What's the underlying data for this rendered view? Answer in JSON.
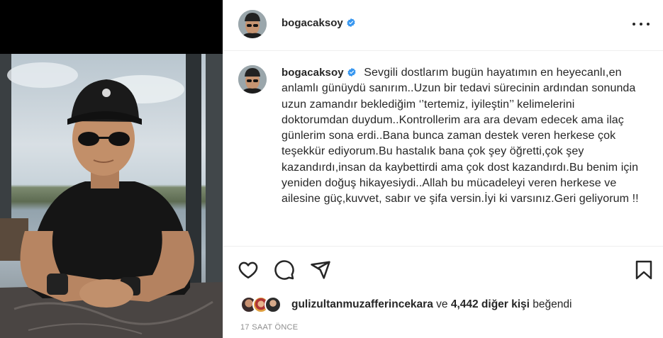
{
  "post": {
    "author": "bogacaksoy",
    "verified": true,
    "caption": "Sevgili dostlarım bugün hayatımın en heyecanlı,en anlamlı günüydü sanırım..Uzun bir tedavi sürecinin ardından sonunda uzun zamandır beklediğim ‘’tertemiz, iyileştin’’ kelimelerini doktorumdan duydum..Kontrollerim ara ara devam edecek ama ilaç günlerim sona erdi..Bana bunca zaman destek veren herkese çok teşekkür ediyorum.Bu hastalık bana çok şey öğretti,çok şey kazandırdı,insan da kaybettirdi ama çok dost kazandırdı.Bu benim için yeniden doğuş hikayesiydi..Allah bu mücadeleyi veren herkese ve ailesine güç,kuvvet, sabır ve şifa versin.İyi ki varsınız.Geri geliyorum !!",
    "likes": {
      "first_liker": "gulizultanmuzafferincekara",
      "connector": "ve",
      "others": "4,442 diğer kişi",
      "suffix": "beğendi"
    },
    "timestamp": "17 SAAT ÖNCE"
  },
  "icons": {
    "verified": "verified-badge-icon",
    "more": "more-options-icon",
    "like": "heart-icon",
    "comment": "comment-icon",
    "share": "share-icon",
    "save": "bookmark-icon"
  },
  "colors": {
    "verified_blue": "#3897f0",
    "text": "#262626",
    "muted": "#8e8e8e",
    "border": "#efefef"
  }
}
